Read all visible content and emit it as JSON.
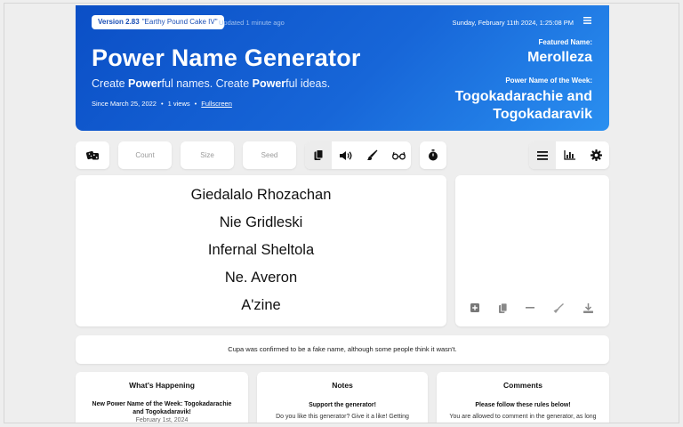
{
  "header": {
    "version_number": "Version 2.83",
    "version_name": "\"Earthy Pound Cake IV\"",
    "updated": "Updated 1 minute ago",
    "date": "Sunday, February 11th 2024, 1:25:08 PM",
    "menu_icon": "hamburger-icon",
    "title": "Power Name Generator",
    "subtitle_parts": [
      "Create ",
      "Power",
      "ful names. Create ",
      "Power",
      "ful ideas."
    ],
    "since": "Since March 25, 2022",
    "views": "1 views",
    "fullscreen": "Fullscreen",
    "featured_label": "Featured Name:",
    "featured_name": "Merolleza",
    "week_label": "Power Name of the Week:",
    "week_name": "Togokadarachie and Togokadaravik",
    "accent": "#1766d8"
  },
  "toolbar": {
    "dice_icon": "dice-icon",
    "count_placeholder": "Count",
    "size_placeholder": "Size",
    "seed_placeholder": "Seed",
    "copy_icon": "copy-icon",
    "speak_icon": "speaker-icon",
    "paint_icon": "brush-icon",
    "glasses_icon": "glasses-icon",
    "timer_icon": "stopwatch-icon",
    "list_icon": "list-icon",
    "chart_icon": "bar-chart-icon",
    "settings_icon": "gear-icon"
  },
  "names": [
    "Giedalalo Rhozachan",
    "Nie Gridleski",
    "Infernal Sheltola",
    "Ne. Averon",
    "A'zine"
  ],
  "side_tools": [
    "plus-square-icon",
    "copy-icon",
    "minus-icon",
    "broom-icon",
    "download-icon"
  ],
  "fact": "Cupa was confirmed to be a fake name, although some people think it wasn't.",
  "cards": [
    {
      "title": "What's Happening",
      "bold": "New Power Name of the Week: Togokadarachie and Togokadaravik!",
      "text": "February 1st, 2024"
    },
    {
      "title": "Notes",
      "bold": "Support the generator!",
      "text": "Do you like this generator? Give it a like! Getting"
    },
    {
      "title": "Comments",
      "bold": "Please follow these rules below!",
      "text": "You are allowed to comment in the generator, as long"
    }
  ]
}
